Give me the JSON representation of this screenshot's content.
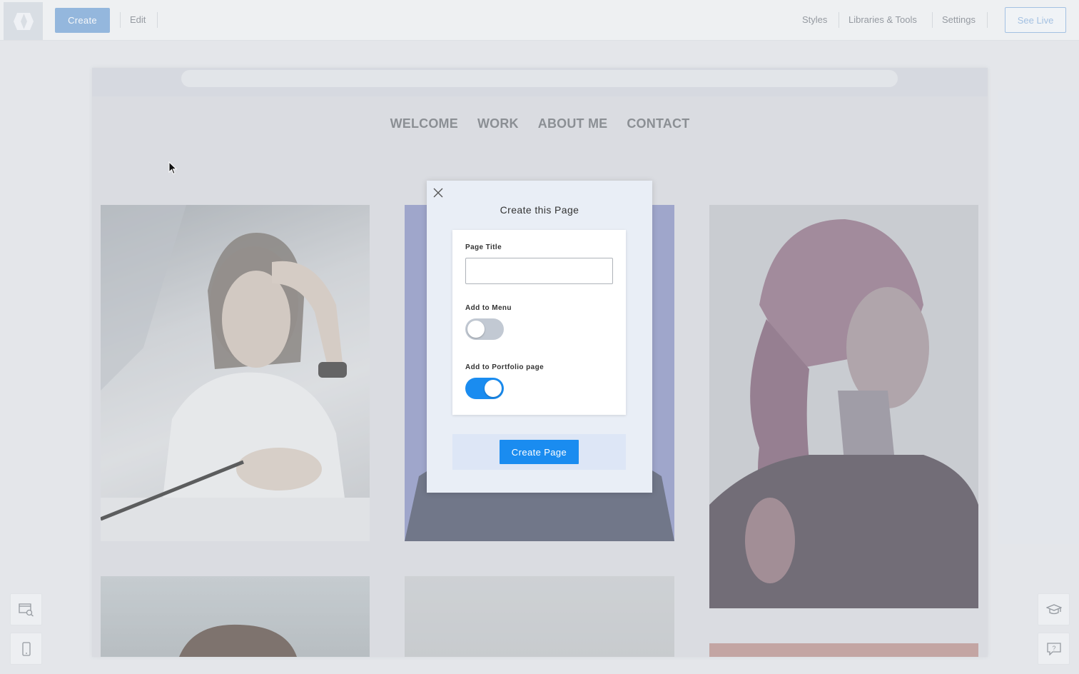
{
  "toolbar": {
    "create_label": "Create",
    "edit_label": "Edit",
    "styles_label": "Styles",
    "libraries_label": "Libraries & Tools",
    "settings_label": "Settings",
    "see_live_label": "See Live"
  },
  "site": {
    "nav": [
      "WELCOME",
      "WORK",
      "ABOUT ME",
      "CONTACT"
    ]
  },
  "modal": {
    "title": "Create this Page",
    "page_title_label": "Page Title",
    "page_title_value": "",
    "add_to_menu_label": "Add to Menu",
    "add_to_menu_on": false,
    "add_to_portfolio_label": "Add to Portfolio page",
    "add_to_portfolio_on": true,
    "submit_label": "Create Page"
  },
  "colors": {
    "accent": "#1a8cf0",
    "toggle_off": "#c2c9d3",
    "create_button": "#7aa7d8"
  },
  "icons": {
    "left_dock": [
      "preview-search-icon",
      "mobile-icon"
    ],
    "right_dock": [
      "graduation-cap-icon",
      "help-chat-icon"
    ]
  }
}
